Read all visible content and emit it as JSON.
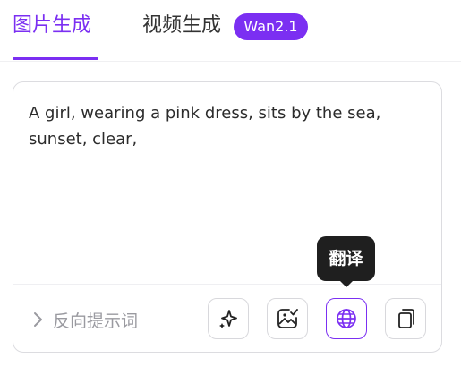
{
  "tabs": {
    "image_generation": "图片生成",
    "video_generation": "视频生成",
    "video_badge": "Wan2.1"
  },
  "prompt": {
    "text": "A girl, wearing a pink dress, sits by the sea,\nsunset, clear,"
  },
  "negative_prompt": {
    "label": "反向提示词",
    "icon": "chevron-right-icon"
  },
  "toolbar": {
    "buttons": [
      {
        "icon": "sparkle-icon"
      },
      {
        "icon": "image-edit-icon"
      },
      {
        "icon": "globe-icon"
      },
      {
        "icon": "copy-icon"
      }
    ]
  },
  "tooltip": {
    "text": "翻译"
  },
  "colors": {
    "accent": "#7b2ff2",
    "tooltip_bg": "#1f1f1f",
    "muted_text": "#9a9aa0"
  }
}
